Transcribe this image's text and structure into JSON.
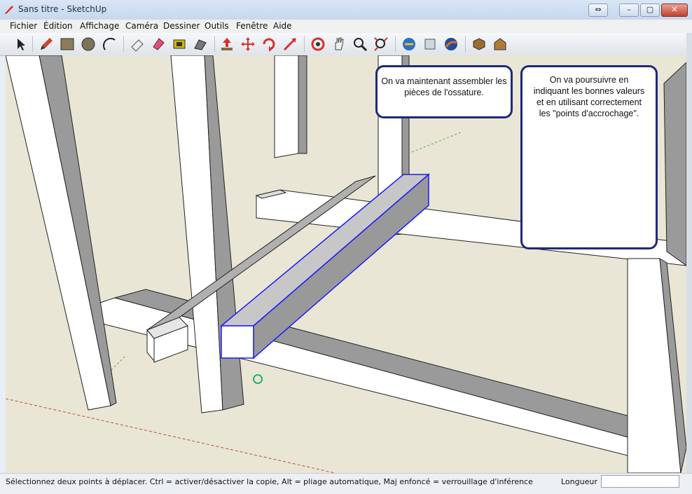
{
  "window": {
    "title": "Sans titre - SketchUp",
    "controls": {
      "restore_label": "⇔",
      "minimize_label": "–",
      "maximize_label": "▢",
      "close_label": "✕"
    }
  },
  "menu": [
    "Fichier",
    "Édition",
    "Affichage",
    "Caméra",
    "Dessiner",
    "Outils",
    "Fenêtre",
    "Aide"
  ],
  "toolbar": {
    "tools": [
      "select-icon",
      "pencil-icon",
      "rectangle-icon",
      "circle-icon",
      "arc-icon",
      "eraser-icon",
      "paint-icon",
      "offset-icon",
      "follow-me-icon",
      "pushpull-icon",
      "move-icon",
      "rotate-icon",
      "scale-icon",
      "orbit-icon",
      "pan-icon",
      "zoom-icon",
      "zoom-extents-icon",
      "geo-location-icon",
      "section-icon",
      "google-earth-icon",
      "component-icon",
      "warehouse-icon"
    ]
  },
  "callouts": {
    "left": "On va maintenant assembler les pièces de l'ossature.",
    "right": "On va poursuivre en indiquant les bonnes valeurs et en utilisant correctement les \"points d'accrochage\"."
  },
  "status": {
    "text": "Sélectionnez deux points à déplacer.  Ctrl = activer/désactiver la copie, Alt = pliage automatique, Maj enfoncé = verrouillage d'inférence",
    "measure_label": "Longueur",
    "measure_value": ""
  },
  "colors": {
    "ground": "#e9e6d5",
    "selection": "#1a1aff",
    "face_light": "#ffffff",
    "face_shade": "#9a9a9a"
  }
}
